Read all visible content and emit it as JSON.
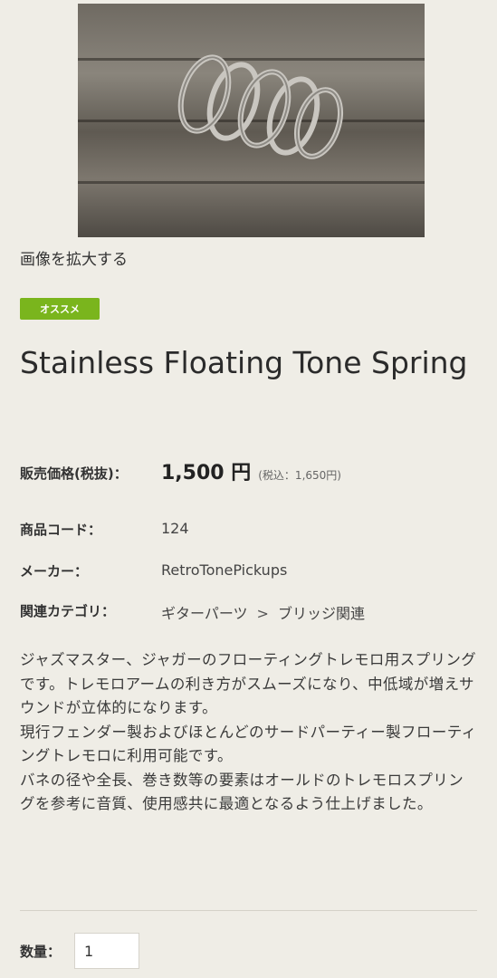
{
  "product_image": {
    "icon": "spring-photo"
  },
  "enlarge_link": "画像を拡大する",
  "badge": "オススメ",
  "title": "Stainless Floating Tone Spring",
  "price": {
    "label": "販売価格(税抜)：",
    "amount": "1,500 円",
    "tax_included": "(税込：1,650円)"
  },
  "code": {
    "label": "商品コード：",
    "value": "124"
  },
  "maker": {
    "label": "メーカー：",
    "value": "RetroTonePickups"
  },
  "category": {
    "label": "関連カテゴリ：",
    "parent": "ギターパーツ",
    "separator": ">",
    "child": "ブリッジ関連"
  },
  "description": [
    "ジャズマスター、ジャガーのフローティングトレモロ用スプリングです。トレモロアームの利き方がスムーズになり、中低域が増えサウンドが立体的になります。",
    "現行フェンダー製およびほとんどのサードパーティー製フローティングトレモロに利用可能です。",
    "バネの径や全長、巻き数等の要素はオールドのトレモロスプリングを参考に音質、使用感共に最適となるよう仕上げました。"
  ],
  "quantity": {
    "label": "数量：",
    "value": "1"
  },
  "colors": {
    "badge": "#7ab51d",
    "background": "#efede6"
  }
}
